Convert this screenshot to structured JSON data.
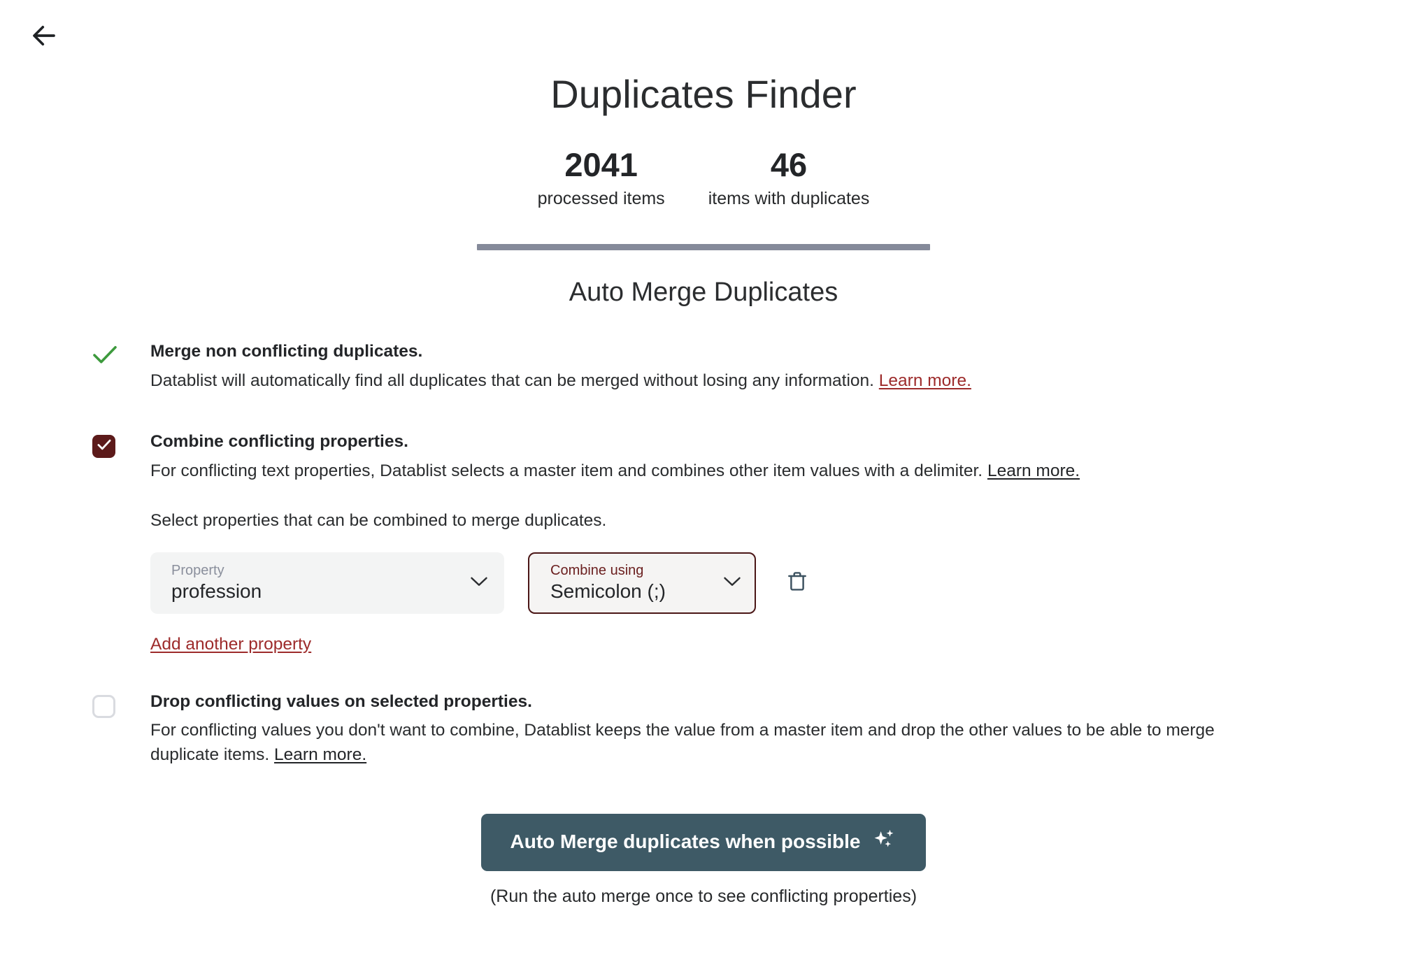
{
  "nav": {
    "back_icon": "arrow-left-icon"
  },
  "header": {
    "title": "Duplicates Finder"
  },
  "stats": [
    {
      "value": "2041",
      "label": "processed items"
    },
    {
      "value": "46",
      "label": "items with duplicates"
    }
  ],
  "section": {
    "title": "Auto Merge Duplicates"
  },
  "options": [
    {
      "state": "check",
      "heading": "Merge non conflicting duplicates.",
      "desc": "Datablist will automatically find all duplicates that can be merged without losing any information.",
      "link": "Learn more."
    },
    {
      "state": "checked",
      "heading": "Combine conflicting properties.",
      "desc": "For conflicting text properties, Datablist selects a master item and combines other item values with a delimiter.",
      "link": "Learn more."
    },
    {
      "state": "unchecked",
      "heading": "Drop conflicting values on selected properties.",
      "desc": "For conflicting values you don't want to combine, Datablist keeps the value from a master item and drop the other values to be able to merge duplicate items.",
      "link": "Learn more."
    }
  ],
  "combine_panel": {
    "instruction": "Select properties that can be combined to merge duplicates.",
    "property_select": {
      "label": "Property",
      "value": "profession"
    },
    "delimiter_select": {
      "label": "Combine using",
      "value": "Semicolon (;)"
    },
    "delete_icon": "trash-icon",
    "add_link": "Add another property"
  },
  "footer": {
    "button_label": "Auto Merge duplicates when possible",
    "button_icon": "sparkles-icon",
    "note": "(Run the auto merge once to see conflicting properties)"
  },
  "colors": {
    "accent_maroon": "#5c1a1a",
    "link_red": "#9d2b2b",
    "button_slate": "#3e5a66",
    "divider_gray": "#858a9a",
    "check_green": "#3d9a3d",
    "trash_slate": "#3d5260"
  }
}
